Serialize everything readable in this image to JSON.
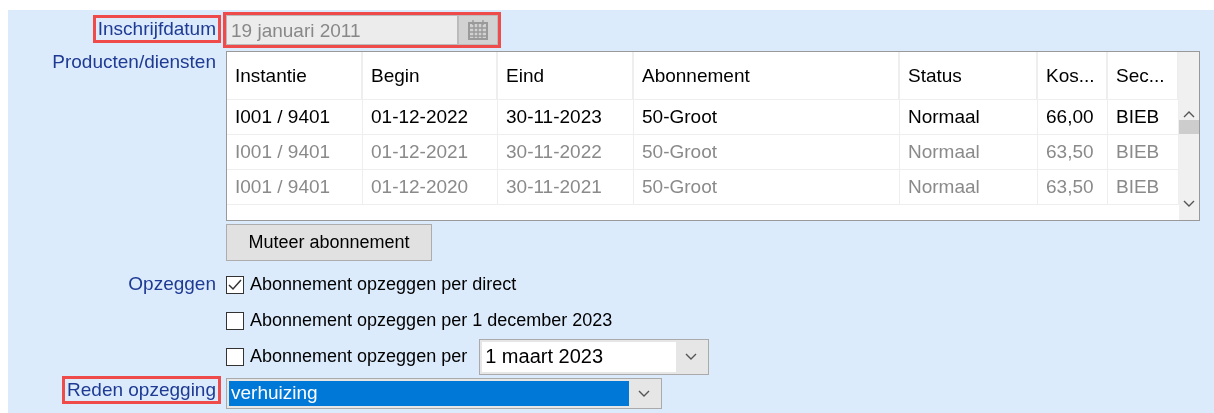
{
  "inschrijfdatum": {
    "label": "Inschrijfdatum",
    "value": "19 januari 2011",
    "disabled": true,
    "highlighted": true
  },
  "products": {
    "label": "Producten/diensten",
    "columns": [
      "Instantie",
      "Begin",
      "Eind",
      "Abonnement",
      "Status",
      "Kos...",
      "Sec..."
    ],
    "rows": [
      {
        "cells": [
          "I001 / 9401",
          "01-12-2022",
          "30-11-2023",
          "50-Groot",
          "Normaal",
          "66,00",
          "BIEB"
        ],
        "active": true
      },
      {
        "cells": [
          "I001 / 9401",
          "01-12-2021",
          "30-11-2022",
          "50-Groot",
          "Normaal",
          "63,50",
          "BIEB"
        ],
        "active": false
      },
      {
        "cells": [
          "I001 / 9401",
          "01-12-2020",
          "30-11-2021",
          "50-Groot",
          "Normaal",
          "63,50",
          "BIEB"
        ],
        "active": false
      }
    ],
    "button": "Muteer abonnement"
  },
  "opzeggen": {
    "label": "Opzeggen",
    "options": [
      {
        "label": "Abonnement opzeggen per direct",
        "checked": true
      },
      {
        "label": "Abonnement opzeggen per 1 december 2023",
        "checked": false
      },
      {
        "label": "Abonnement opzeggen per",
        "checked": false,
        "date": "1 maart 2023"
      }
    ]
  },
  "reden": {
    "label": "Reden opzegging",
    "value": "verhuizing",
    "selected": true,
    "highlighted": true
  }
}
